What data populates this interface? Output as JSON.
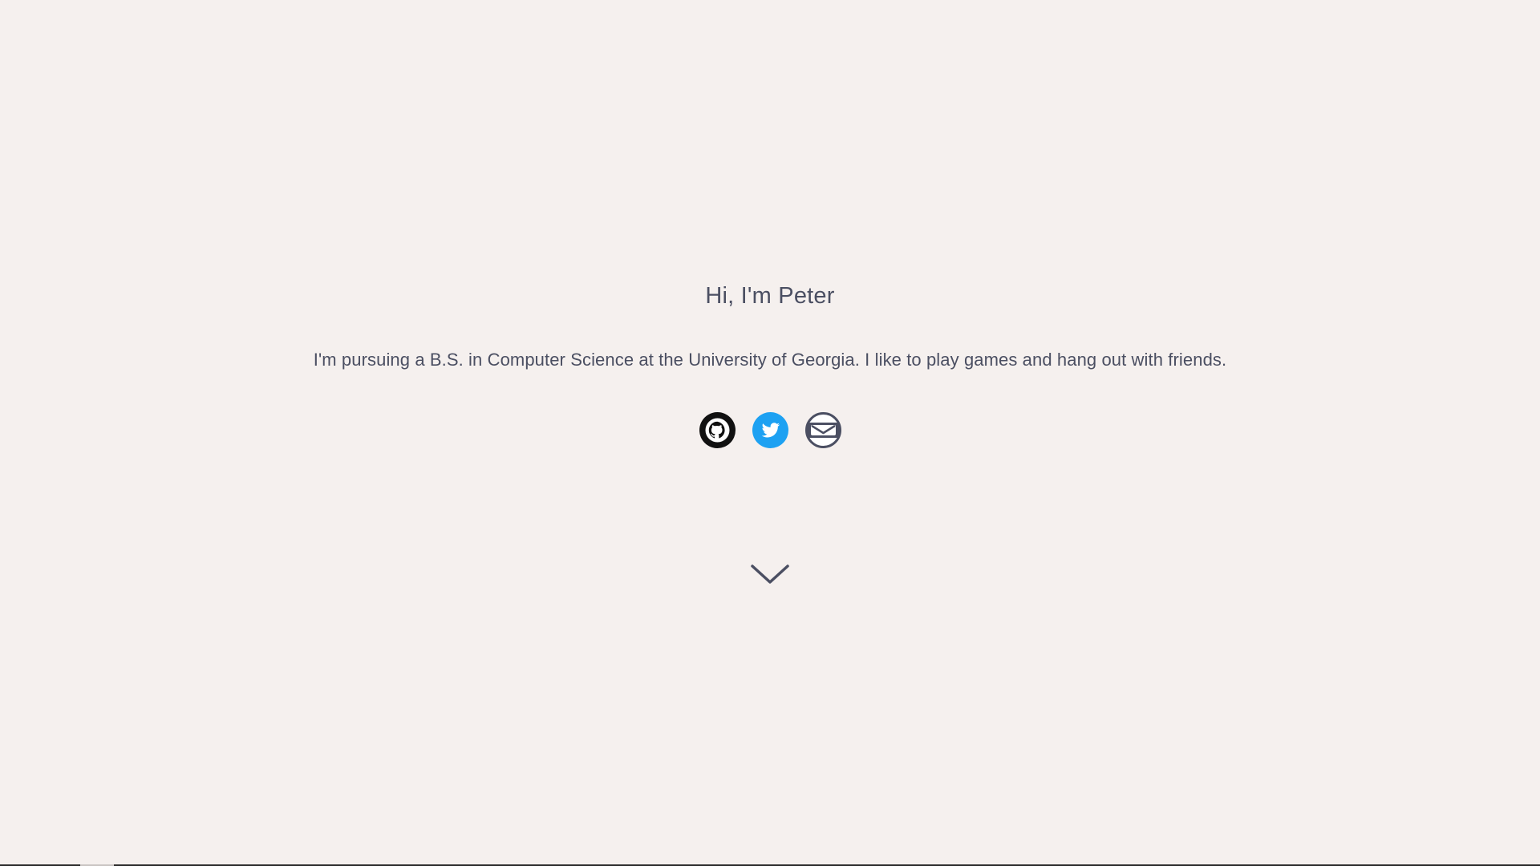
{
  "hero": {
    "greeting": "Hi, I'm Peter",
    "bio": "I'm pursuing a B.S. in Computer Science at the University of Georgia. I like to play games and hang out with friends."
  },
  "socials": [
    {
      "icon": "github-icon",
      "color": "#111111"
    },
    {
      "icon": "twitter-icon",
      "color": "#1da1f2"
    },
    {
      "icon": "email-icon",
      "color": "#4b4f62"
    }
  ],
  "scroll": {
    "icon": "chevron-down-icon"
  },
  "colors": {
    "background": "#f5f0ee",
    "text": "#4b4f62",
    "github": "#111111",
    "twitter": "#1da1f2",
    "email": "#4b4f62"
  }
}
